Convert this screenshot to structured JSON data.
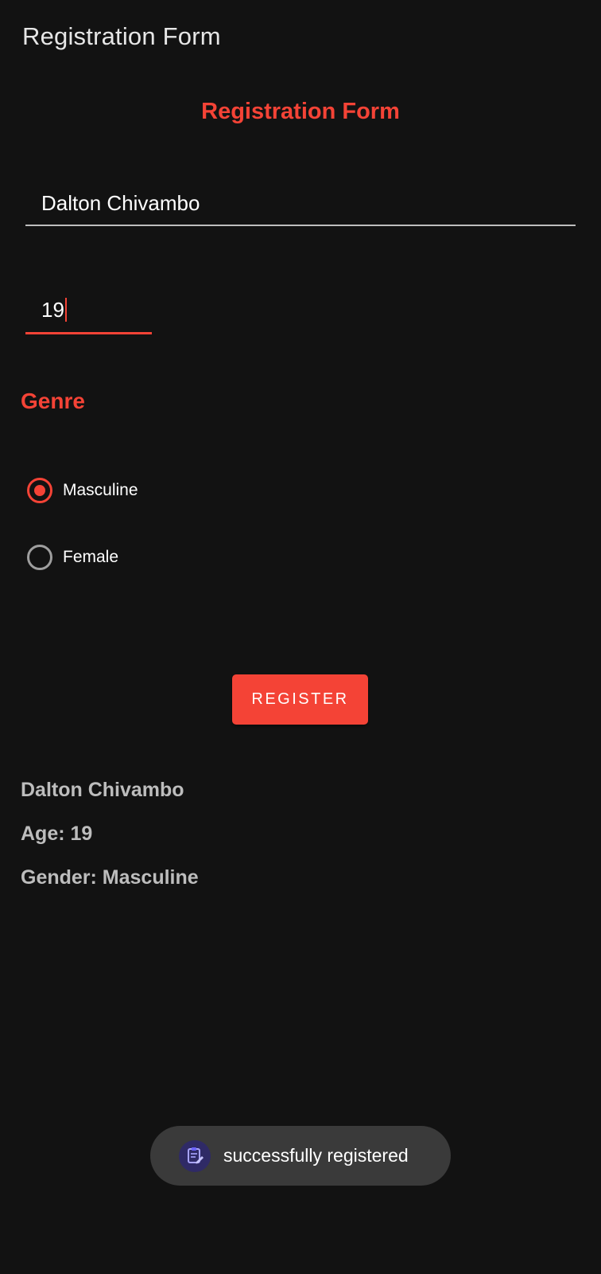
{
  "app_bar": {
    "title": "Registration Form"
  },
  "form": {
    "heading": "Registration Form",
    "name_value": "Dalton Chivambo",
    "age_value": "19",
    "genre_label": "Genre",
    "gender_options": [
      {
        "label": "Masculine",
        "checked": true
      },
      {
        "label": "Female",
        "checked": false
      }
    ],
    "register_label": "REGISTER"
  },
  "result": {
    "name": "Dalton Chivambo",
    "age": "Age: 19",
    "gender": "Gender: Masculine"
  },
  "toast": {
    "message": "successfully registered",
    "icon": "app-icon"
  },
  "colors": {
    "background": "#121212",
    "accent": "#f44336",
    "muted_text": "#bdbdbd",
    "toast_bg": "#3a3a3a"
  }
}
